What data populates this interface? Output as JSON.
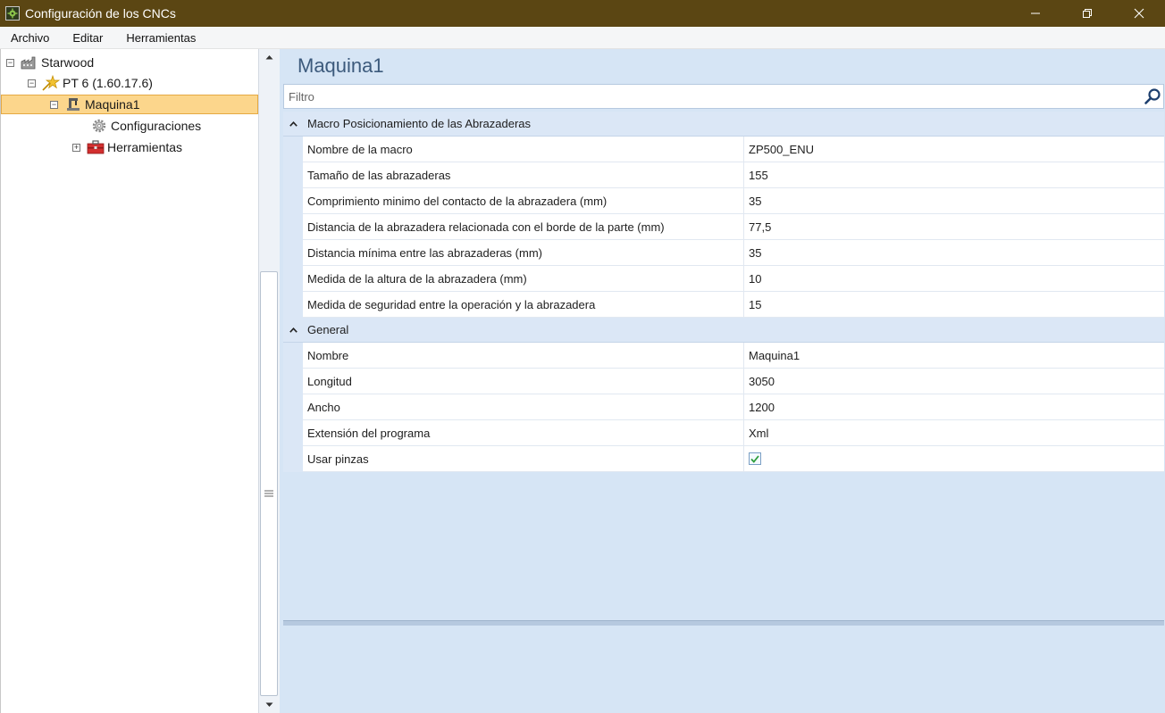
{
  "window": {
    "title": "Configuración de los CNCs",
    "controls": [
      "minimize",
      "restore",
      "close"
    ]
  },
  "menu": [
    "Archivo",
    "Editar",
    "Herramientas"
  ],
  "tree": {
    "items": [
      {
        "label": "Starwood",
        "expander": "⊟",
        "icon": "factory-icon"
      },
      {
        "label": "PT 6 (1.60.17.6)",
        "expander": "⊟",
        "icon": "star-tool-icon"
      },
      {
        "label": "Maquina1",
        "expander": "⊟",
        "icon": "machine-icon",
        "selected": true
      },
      {
        "label": "Configuraciones",
        "icon": "gear-icon"
      },
      {
        "label": "Herramientas",
        "expander": "⊞",
        "icon": "toolbox-icon"
      }
    ]
  },
  "main": {
    "title": "Maquina1",
    "filter_placeholder": "Filtro",
    "categories": [
      {
        "label": "Macro Posicionamiento de las Abrazaderas",
        "rows": [
          {
            "name": "Nombre de la macro",
            "value": "ZP500_ENU"
          },
          {
            "name": "Tamaño de las abrazaderas",
            "value": "155"
          },
          {
            "name": "Comprimiento minimo del contacto de la abrazadera (mm)",
            "value": "35"
          },
          {
            "name": "Distancia de la abrazadera relacionada con el borde de la parte (mm)",
            "value": "77,5"
          },
          {
            "name": "Distancia mínima entre las abrazaderas (mm)",
            "value": "35"
          },
          {
            "name": "Medida de la altura de la abrazadera (mm)",
            "value": "10"
          },
          {
            "name": "Medida de seguridad entre la operación y la abrazadera",
            "value": "15"
          }
        ]
      },
      {
        "label": "General",
        "rows": [
          {
            "name": "Nombre",
            "value": "Maquina1"
          },
          {
            "name": "Longitud",
            "value": "3050"
          },
          {
            "name": "Ancho",
            "value": "1200"
          },
          {
            "name": "Extensión del programa",
            "value": "Xml"
          },
          {
            "name": "Usar pinzas",
            "checked": true
          }
        ]
      }
    ]
  },
  "colors": {
    "titlebar": "#5b4613",
    "panel_bg": "#d6e5f5",
    "selection": "#fcd68c",
    "title_text": "#3c5a7c"
  }
}
